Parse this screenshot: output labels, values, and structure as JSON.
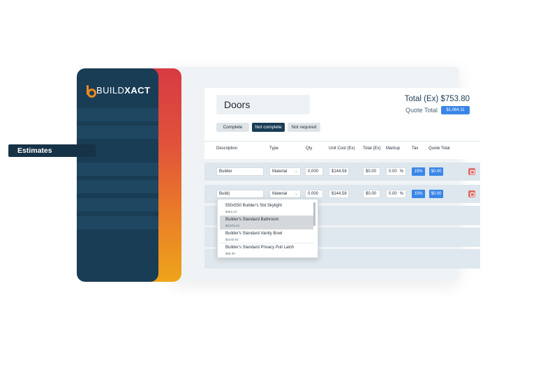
{
  "brand": {
    "logo_pre": "BUILD",
    "logo_post": "XACT"
  },
  "sidebar": {
    "active_item": "Estimates"
  },
  "header": {
    "title": "Doors",
    "total_ex": "Total (Ex) $753.80",
    "quote_total_label": "Quote Total",
    "quote_total_value": "$1,064.11"
  },
  "status": {
    "complete": "Complete",
    "not_complete": "Not complete",
    "not_required": "Not required"
  },
  "columns": [
    "Description",
    "Type",
    "Qty",
    "Unit Cost (Ex)",
    "Total (Ex)",
    "Markup",
    "Tax",
    "Quote Total"
  ],
  "rows": [
    {
      "description": "Builder",
      "type": "Material",
      "qty": "0.000",
      "unit_cost": "$144.58",
      "total": "$0.00",
      "markup": "0.00",
      "markup_unit": "%",
      "tax": "15%",
      "quote_total": "$0.00"
    },
    {
      "description": "Build|",
      "type": "Material",
      "qty": "0.000",
      "unit_cost": "$144.58",
      "total": "$0.00",
      "markup": "0.00",
      "markup_unit": "%",
      "tax": "15%",
      "quote_total": "$0.00"
    }
  ],
  "suggestions": [
    {
      "name": "550x550 Builder's Std Skylight",
      "price": "$462.24"
    },
    {
      "name": "Builder's Standard Bathroom",
      "price": "$2,576.44"
    },
    {
      "name": "Builder's Standard Vanity Bowl",
      "price": "$1040.54"
    },
    {
      "name": "Builder's Standard Privacy Pull Latch",
      "price": "$35.39"
    }
  ],
  "colors": {
    "sidebar": "#193d55",
    "accent": "#3a86e8",
    "brand_orange": "#f08a22",
    "delete": "#e0726e"
  },
  "icons": {
    "delete": "trash-icon",
    "select": "chevron-down-icon"
  }
}
